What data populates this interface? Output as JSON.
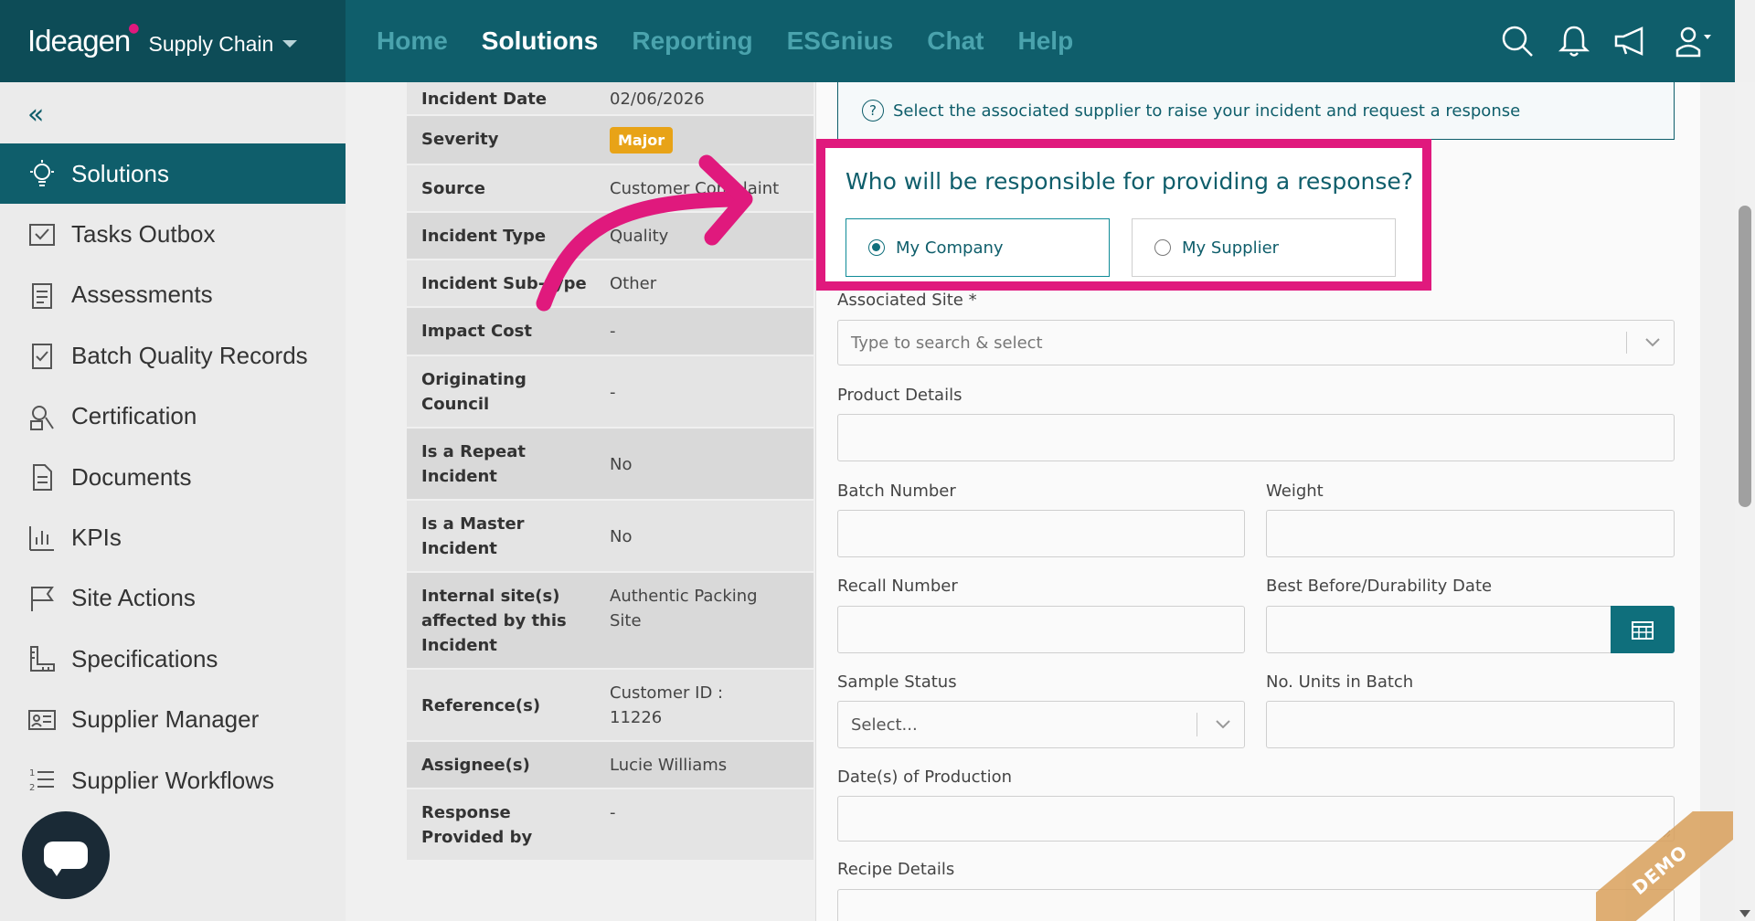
{
  "brand": {
    "logo": "Ideagen",
    "product": "Supply Chain"
  },
  "nav": [
    "Home",
    "Solutions",
    "Reporting",
    "ESGnius",
    "Chat",
    "Help"
  ],
  "nav_active": "Solutions",
  "sidebar": {
    "items": [
      {
        "label": "Solutions",
        "icon": "lightbulb-icon",
        "active": true
      },
      {
        "label": "Tasks Outbox",
        "icon": "outbox-icon"
      },
      {
        "label": "Assessments",
        "icon": "clipboard-icon"
      },
      {
        "label": "Batch Quality Records",
        "icon": "clipboard-check-icon"
      },
      {
        "label": "Certification",
        "icon": "certificate-icon"
      },
      {
        "label": "Documents",
        "icon": "document-icon"
      },
      {
        "label": "KPIs",
        "icon": "bar-chart-icon"
      },
      {
        "label": "Site Actions",
        "icon": "flag-icon"
      },
      {
        "label": "Specifications",
        "icon": "ruler-icon"
      },
      {
        "label": "Supplier Manager",
        "icon": "id-card-icon"
      },
      {
        "label": "Supplier Workflows",
        "icon": "numbered-list-icon"
      }
    ]
  },
  "details": [
    {
      "label": "Incident Date",
      "value": "02/06/2026"
    },
    {
      "label": "Severity",
      "value": "Major",
      "badge": true
    },
    {
      "label": "Source",
      "value": "Customer Complaint"
    },
    {
      "label": "Incident Type",
      "value": "Quality"
    },
    {
      "label": "Incident Sub-type",
      "value": "Other"
    },
    {
      "label": "Impact Cost",
      "value": "-"
    },
    {
      "label": "Originating Council",
      "value": "-"
    },
    {
      "label": "Is a Repeat Incident",
      "value": "No"
    },
    {
      "label": "Is a Master Incident",
      "value": "No"
    },
    {
      "label": "Internal site(s) affected by this Incident",
      "value": "Authentic Packing Site"
    },
    {
      "label": "Reference(s)",
      "value": "Customer ID : 11226"
    },
    {
      "label": "Assignee(s)",
      "value": "Lucie Williams"
    },
    {
      "label": "Response Provided by",
      "value": "-"
    }
  ],
  "form": {
    "info": "Select the associated supplier to raise your incident and request a response",
    "question": "Who will be responsible for providing a response?",
    "option_company": "My Company",
    "option_supplier": "My Supplier",
    "associated_site_label": "Associated Site *",
    "associated_site_placeholder": "Type to search & select",
    "product_details_label": "Product Details",
    "batch_number_label": "Batch Number",
    "weight_label": "Weight",
    "recall_number_label": "Recall Number",
    "best_before_label": "Best Before/Durability Date",
    "sample_status_label": "Sample Status",
    "sample_status_value": "Select...",
    "units_label": "No. Units in Batch",
    "production_dates_label": "Date(s) of Production",
    "recipe_label": "Recipe Details"
  },
  "demo_label": "DEMO",
  "colors": {
    "primary": "#0f5e6b",
    "highlight": "#e0197d",
    "badge": "#e8a317"
  }
}
